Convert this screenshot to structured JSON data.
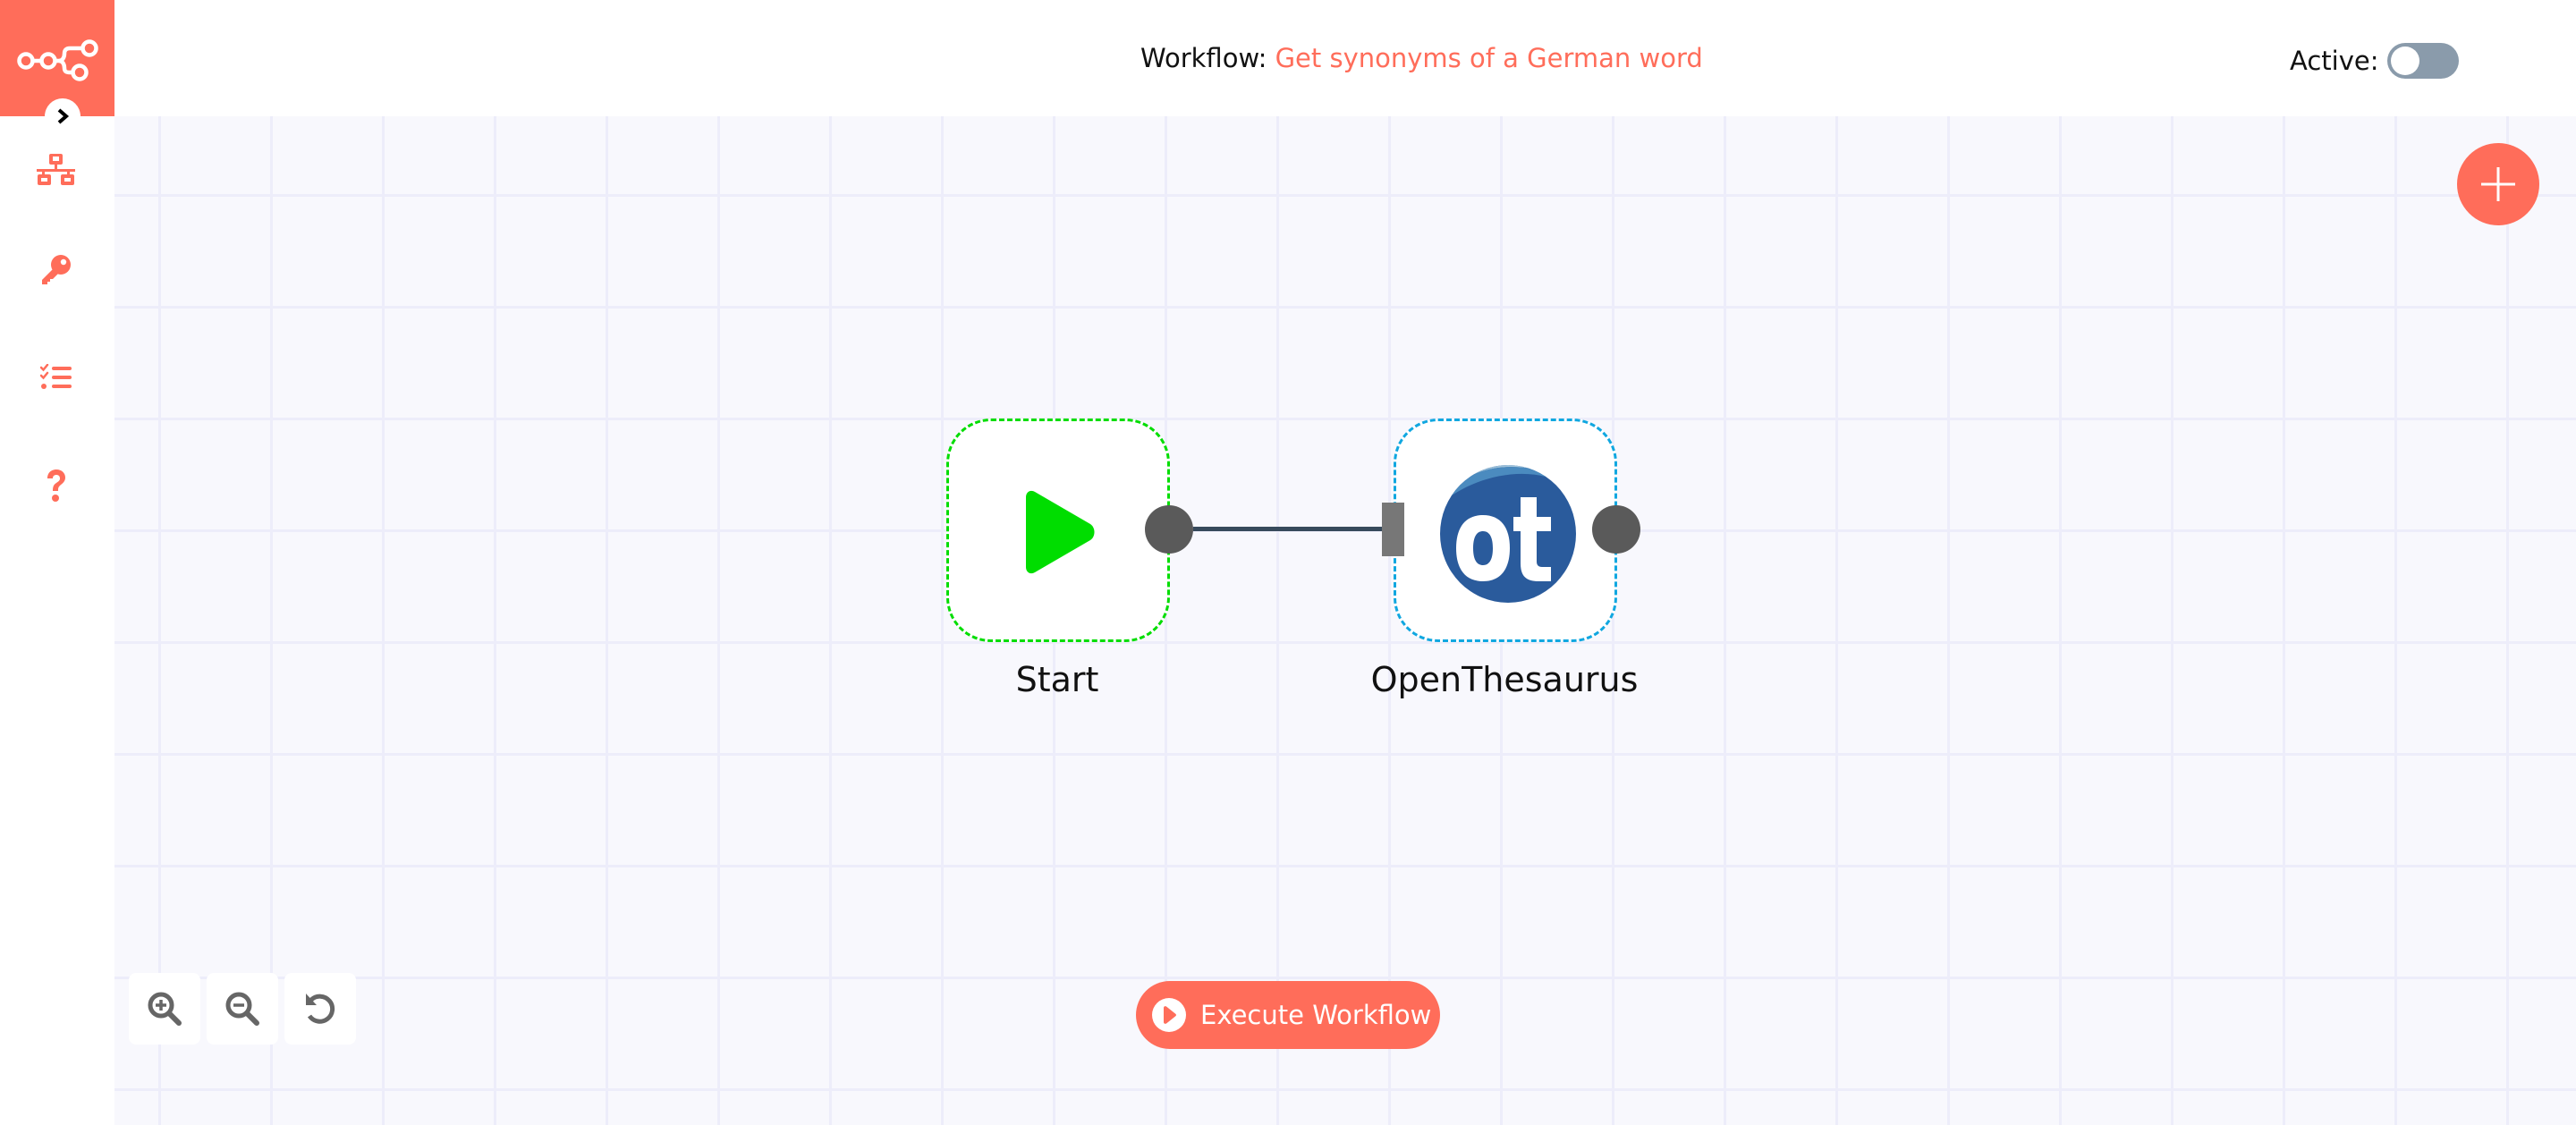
{
  "app": {
    "brand_color": "#ff6d5a",
    "logo_icon": "n8n-logo-icon"
  },
  "header": {
    "workflow_prefix": "Workflow:",
    "workflow_name": "Get synonyms of a German word",
    "active_label": "Active:",
    "active_toggle": {
      "checked": false,
      "color_off": "#8a9bab"
    }
  },
  "sidebar": {
    "collapse_icon": "chevron-right-icon",
    "items": [
      {
        "id": "workflows",
        "icon": "network-icon"
      },
      {
        "id": "credentials",
        "icon": "key-icon"
      },
      {
        "id": "executions",
        "icon": "tasks-list-icon"
      },
      {
        "id": "help",
        "icon": "question-icon"
      }
    ]
  },
  "canvas": {
    "nodes": [
      {
        "name": "Start",
        "icon": "play-icon",
        "border_color": "#00dd00",
        "icon_color": "#00dd00"
      },
      {
        "name": "OpenThesaurus",
        "icon": "openthesaurus-logo",
        "border_color": "#10a7e0",
        "logo_text": "ot",
        "logo_color": "#2a5b9c"
      }
    ],
    "connections": [
      {
        "from": "Start",
        "to": "OpenThesaurus"
      }
    ],
    "add_node_icon": "plus-icon"
  },
  "controls": {
    "zoom_in_icon": "zoom-in-icon",
    "zoom_out_icon": "zoom-out-icon",
    "reset_icon": "reset-zoom-icon",
    "execute_label": "Execute Workflow"
  }
}
